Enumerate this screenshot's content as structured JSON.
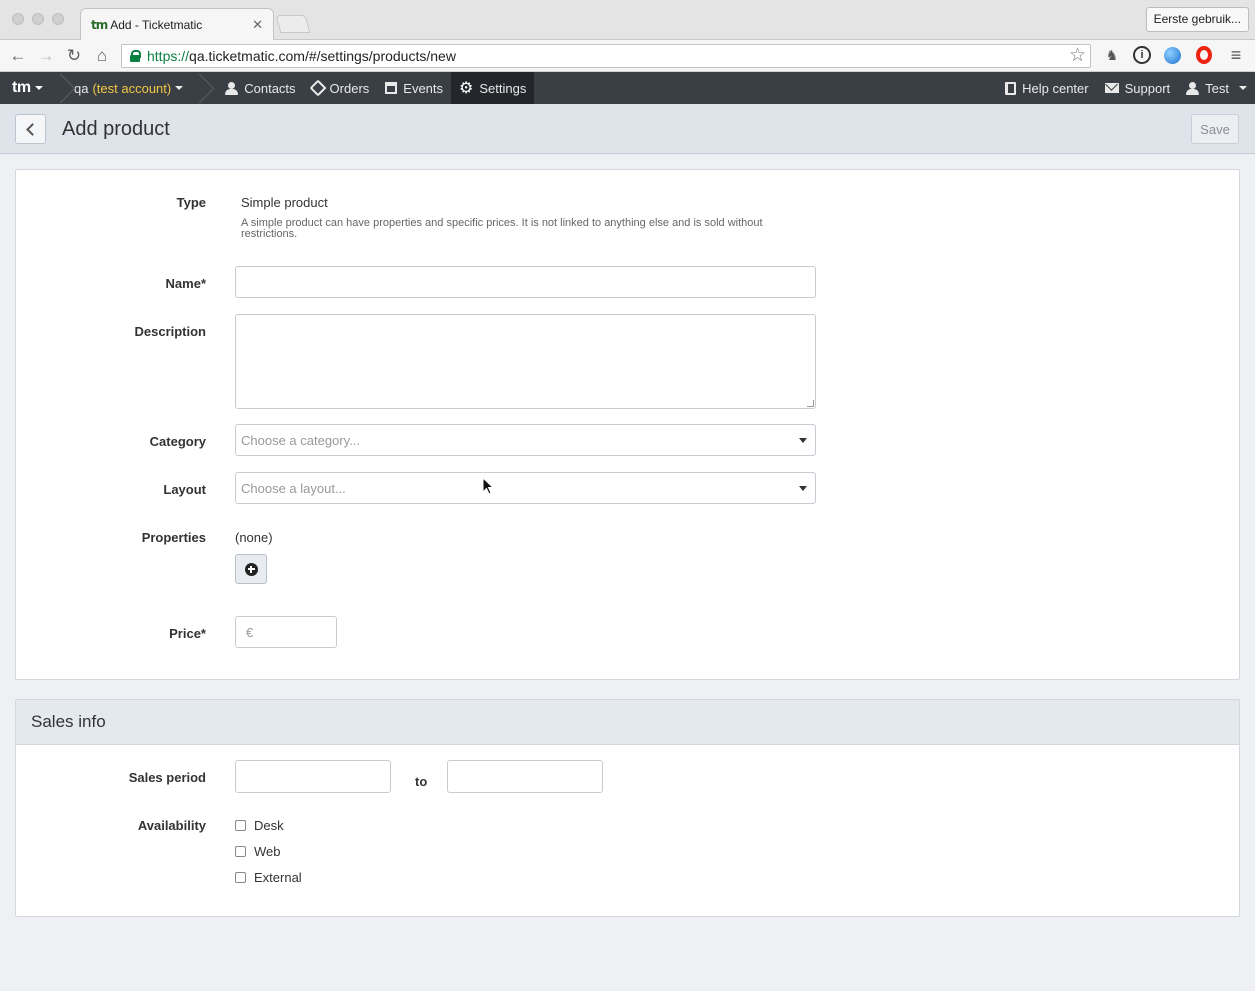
{
  "browser": {
    "tab_title": "Add - Ticketmatic",
    "tab_favicon": "tm",
    "tab_close": "✕",
    "profile_button": "Eerste gebruik...",
    "url_scheme": "https://",
    "url_rest": "qa.ticketmatic.com/#/settings/products/new",
    "nav_icons": [
      "back-arrow-icon",
      "forward-arrow-icon",
      "reload-icon",
      "home-icon"
    ],
    "extension_icons": [
      "evernote-icon",
      "1password-icon",
      "globe-icon",
      "opera-icon",
      "menu-icon"
    ]
  },
  "app_nav": {
    "brand": "tm",
    "account_name": "qa",
    "account_note": "(test account)",
    "items": [
      {
        "label": "Contacts",
        "icon": "user-icon"
      },
      {
        "label": "Orders",
        "icon": "tag-icon"
      },
      {
        "label": "Events",
        "icon": "calendar-icon"
      },
      {
        "label": "Settings",
        "icon": "gear-icon",
        "active": true
      }
    ],
    "right_items": [
      {
        "label": "Help center",
        "icon": "book-icon"
      },
      {
        "label": "Support",
        "icon": "mail-icon"
      },
      {
        "label": "Test",
        "icon": "user-icon"
      }
    ]
  },
  "header": {
    "title": "Add product",
    "save_label": "Save"
  },
  "form": {
    "type_label": "Type",
    "type_value": "Simple product",
    "type_help": "A simple product can have properties and specific prices. It is not linked to anything else and is sold without restrictions.",
    "name_label": "Name*",
    "name_value": "",
    "description_label": "Description",
    "description_value": "",
    "category_label": "Category",
    "category_placeholder": "Choose a category...",
    "layout_label": "Layout",
    "layout_placeholder": "Choose a layout...",
    "properties_label": "Properties",
    "properties_value": "(none)",
    "price_label": "Price*",
    "price_placeholder": "€"
  },
  "sales": {
    "heading": "Sales info",
    "period_label": "Sales period",
    "period_to": "to",
    "availability_label": "Availability",
    "channels": [
      {
        "label": "Desk",
        "checked": false
      },
      {
        "label": "Web",
        "checked": false
      },
      {
        "label": "External",
        "checked": false
      }
    ]
  },
  "colors": {
    "navbar": "#3a3f45",
    "navbar_active": "#23272b",
    "account_highlight": "#f2c744",
    "header_bg": "#dfe3ea",
    "page_bg": "#eef0f3"
  }
}
